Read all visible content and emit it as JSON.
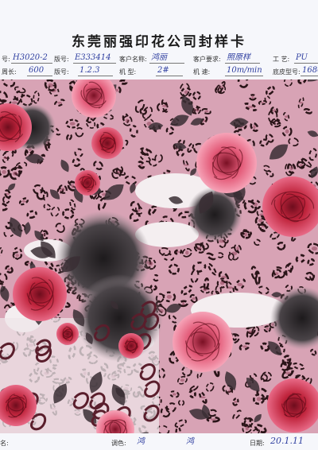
{
  "document": {
    "title": "东莞丽强印花公司封样卡",
    "fields": {
      "pattern_no_label": "号:",
      "pattern_no_value": "H3020-2",
      "version_label": "版号:",
      "version_value": "E333414",
      "customer_name_label": "客户名称:",
      "customer_name_value": "鸿丽",
      "customer_req_label": "客户要求:",
      "customer_req_value": "照原样",
      "process_label": "工 艺:",
      "process_value": "PU",
      "cycle_label": "周长:",
      "cycle_value": "600",
      "color_label": "版号:",
      "color_value": "1.2.3",
      "machine_label": "机 型:",
      "machine_value": "2#",
      "speed_label": "机 速:",
      "speed_value": "10m/min",
      "base_paper_label": "底皮型号:",
      "base_paper_value": "1680"
    },
    "footer": {
      "left_label": "名:",
      "toner_label": "调色:",
      "sign1": "鸿",
      "sign2": "鸿",
      "date_label": "日期:",
      "date_value": "20.1.11"
    }
  },
  "colors": {
    "ink_blue": "#2f3fa0",
    "leopard_base": "#d8a3b5",
    "spot_dark": "#2a1418",
    "rose_red": "#c0243c",
    "rose_pink": "#e35a78",
    "leaf_dark": "#3a2e34"
  }
}
